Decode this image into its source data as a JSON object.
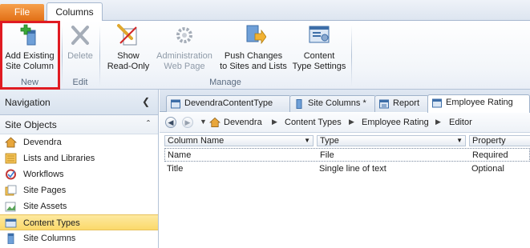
{
  "ribbon": {
    "tabs": {
      "file": "File",
      "columns": "Columns"
    },
    "buttons": {
      "add_existing_line1": "Add Existing",
      "add_existing_line2": "Site Column",
      "delete": "Delete",
      "show_line1": "Show",
      "show_line2": "Read-Only",
      "admin_line1": "Administration",
      "admin_line2": "Web Page",
      "push_line1": "Push Changes",
      "push_line2": "to Sites and Lists",
      "content_type_line1": "Content",
      "content_type_line2": "Type Settings"
    },
    "groups": {
      "new": "New",
      "edit": "Edit",
      "manage": "Manage"
    }
  },
  "navigation": {
    "title": "Navigation",
    "section": "Site Objects",
    "items": [
      {
        "label": "Devendra",
        "icon": "home-icon"
      },
      {
        "label": "Lists and Libraries",
        "icon": "list-icon"
      },
      {
        "label": "Workflows",
        "icon": "workflow-icon"
      },
      {
        "label": "Site Pages",
        "icon": "pages-icon"
      },
      {
        "label": "Site Assets",
        "icon": "assets-icon"
      },
      {
        "label": "Content Types",
        "icon": "content-type-icon",
        "selected": true
      },
      {
        "label": "Site Columns",
        "icon": "column-icon"
      }
    ]
  },
  "doc_tabs": [
    {
      "label": "DevendraContentType",
      "active": false
    },
    {
      "label": "Site Columns *",
      "active": false
    },
    {
      "label": "Report",
      "active": false
    },
    {
      "label": "Employee Rating",
      "active": true
    }
  ],
  "breadcrumb": [
    "Devendra",
    "Content Types",
    "Employee Rating",
    "Editor"
  ],
  "grid": {
    "headers": [
      "Column Name",
      "Type",
      "Property"
    ],
    "rows": [
      {
        "name": "Name",
        "type": "File",
        "property": "Required"
      },
      {
        "name": "Title",
        "type": "Single line of text",
        "property": "Optional"
      }
    ]
  },
  "colors": {
    "accent_orange": "#e26f16",
    "highlight_red": "#e01b22",
    "selection_yellow": "#fbd96a"
  }
}
